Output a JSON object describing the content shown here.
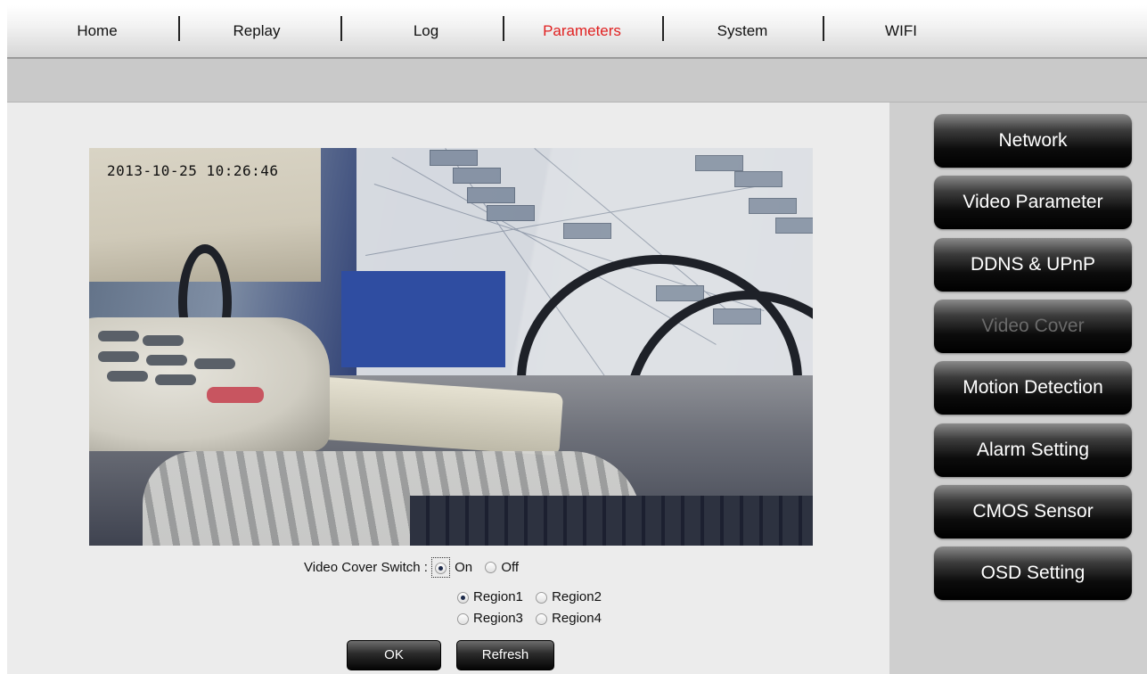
{
  "nav": {
    "items": [
      {
        "label": "Home"
      },
      {
        "label": "Replay"
      },
      {
        "label": "Log"
      },
      {
        "label": "Parameters",
        "active": true
      },
      {
        "label": "System"
      },
      {
        "label": "WIFI"
      }
    ],
    "active_color": "#e02020"
  },
  "video": {
    "timestamp": "2013-10-25  10:26:46",
    "cover_color": "#2f4da1"
  },
  "form": {
    "switch_label": "Video Cover Switch :",
    "switch_options": [
      {
        "label": "On",
        "checked": true
      },
      {
        "label": "Off",
        "checked": false
      }
    ],
    "regions": [
      {
        "label": "Region1",
        "checked": true
      },
      {
        "label": "Region2",
        "checked": false
      },
      {
        "label": "Region3",
        "checked": false
      },
      {
        "label": "Region4",
        "checked": false
      }
    ],
    "ok_label": "OK",
    "refresh_label": "Refresh"
  },
  "sidebar": {
    "items": [
      {
        "label": "Network"
      },
      {
        "label": "Video Parameter"
      },
      {
        "label": "DDNS & UPnP"
      },
      {
        "label": "Video Cover",
        "selected": true
      },
      {
        "label": "Motion Detection"
      },
      {
        "label": "Alarm Setting"
      },
      {
        "label": "CMOS Sensor"
      },
      {
        "label": "OSD Setting"
      }
    ]
  }
}
